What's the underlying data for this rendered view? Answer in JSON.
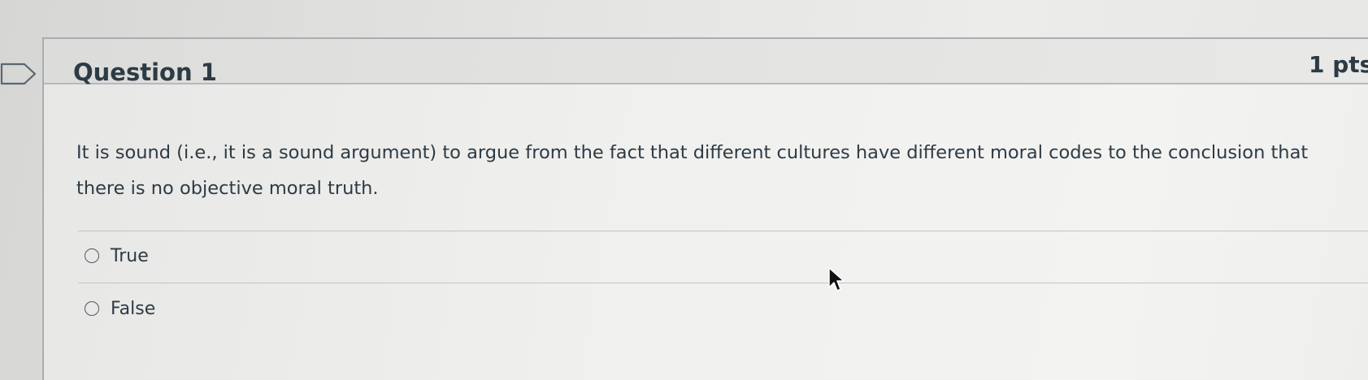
{
  "question": {
    "title": "Question 1",
    "points": "1 pts",
    "text_line1": "It is sound (i.e., it is a sound argument) to argue from the fact that different cultures have different moral codes to the conclusion that",
    "text_line2": "there is no objective moral truth."
  },
  "answers": [
    {
      "label": "True",
      "selected": false
    },
    {
      "label": "False",
      "selected": false
    }
  ],
  "icons": {
    "flag": "flag-question-icon",
    "cursor": "mouse-pointer-icon"
  },
  "colors": {
    "text": "#2d3b45",
    "header_bg": "#e3e3e1",
    "border": "#a9aeb2"
  }
}
